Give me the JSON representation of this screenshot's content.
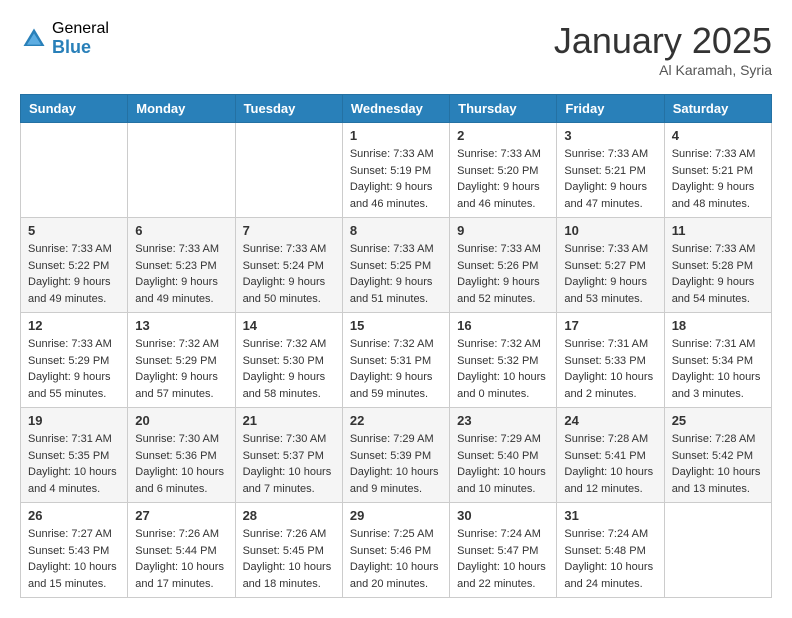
{
  "header": {
    "logo_general": "General",
    "logo_blue": "Blue",
    "month": "January 2025",
    "location": "Al Karamah, Syria"
  },
  "days_of_week": [
    "Sunday",
    "Monday",
    "Tuesday",
    "Wednesday",
    "Thursday",
    "Friday",
    "Saturday"
  ],
  "weeks": [
    [
      {
        "day": "",
        "info": ""
      },
      {
        "day": "",
        "info": ""
      },
      {
        "day": "",
        "info": ""
      },
      {
        "day": "1",
        "info": "Sunrise: 7:33 AM\nSunset: 5:19 PM\nDaylight: 9 hours and 46 minutes."
      },
      {
        "day": "2",
        "info": "Sunrise: 7:33 AM\nSunset: 5:20 PM\nDaylight: 9 hours and 46 minutes."
      },
      {
        "day": "3",
        "info": "Sunrise: 7:33 AM\nSunset: 5:21 PM\nDaylight: 9 hours and 47 minutes."
      },
      {
        "day": "4",
        "info": "Sunrise: 7:33 AM\nSunset: 5:21 PM\nDaylight: 9 hours and 48 minutes."
      }
    ],
    [
      {
        "day": "5",
        "info": "Sunrise: 7:33 AM\nSunset: 5:22 PM\nDaylight: 9 hours and 49 minutes."
      },
      {
        "day": "6",
        "info": "Sunrise: 7:33 AM\nSunset: 5:23 PM\nDaylight: 9 hours and 49 minutes."
      },
      {
        "day": "7",
        "info": "Sunrise: 7:33 AM\nSunset: 5:24 PM\nDaylight: 9 hours and 50 minutes."
      },
      {
        "day": "8",
        "info": "Sunrise: 7:33 AM\nSunset: 5:25 PM\nDaylight: 9 hours and 51 minutes."
      },
      {
        "day": "9",
        "info": "Sunrise: 7:33 AM\nSunset: 5:26 PM\nDaylight: 9 hours and 52 minutes."
      },
      {
        "day": "10",
        "info": "Sunrise: 7:33 AM\nSunset: 5:27 PM\nDaylight: 9 hours and 53 minutes."
      },
      {
        "day": "11",
        "info": "Sunrise: 7:33 AM\nSunset: 5:28 PM\nDaylight: 9 hours and 54 minutes."
      }
    ],
    [
      {
        "day": "12",
        "info": "Sunrise: 7:33 AM\nSunset: 5:29 PM\nDaylight: 9 hours and 55 minutes."
      },
      {
        "day": "13",
        "info": "Sunrise: 7:32 AM\nSunset: 5:29 PM\nDaylight: 9 hours and 57 minutes."
      },
      {
        "day": "14",
        "info": "Sunrise: 7:32 AM\nSunset: 5:30 PM\nDaylight: 9 hours and 58 minutes."
      },
      {
        "day": "15",
        "info": "Sunrise: 7:32 AM\nSunset: 5:31 PM\nDaylight: 9 hours and 59 minutes."
      },
      {
        "day": "16",
        "info": "Sunrise: 7:32 AM\nSunset: 5:32 PM\nDaylight: 10 hours and 0 minutes."
      },
      {
        "day": "17",
        "info": "Sunrise: 7:31 AM\nSunset: 5:33 PM\nDaylight: 10 hours and 2 minutes."
      },
      {
        "day": "18",
        "info": "Sunrise: 7:31 AM\nSunset: 5:34 PM\nDaylight: 10 hours and 3 minutes."
      }
    ],
    [
      {
        "day": "19",
        "info": "Sunrise: 7:31 AM\nSunset: 5:35 PM\nDaylight: 10 hours and 4 minutes."
      },
      {
        "day": "20",
        "info": "Sunrise: 7:30 AM\nSunset: 5:36 PM\nDaylight: 10 hours and 6 minutes."
      },
      {
        "day": "21",
        "info": "Sunrise: 7:30 AM\nSunset: 5:37 PM\nDaylight: 10 hours and 7 minutes."
      },
      {
        "day": "22",
        "info": "Sunrise: 7:29 AM\nSunset: 5:39 PM\nDaylight: 10 hours and 9 minutes."
      },
      {
        "day": "23",
        "info": "Sunrise: 7:29 AM\nSunset: 5:40 PM\nDaylight: 10 hours and 10 minutes."
      },
      {
        "day": "24",
        "info": "Sunrise: 7:28 AM\nSunset: 5:41 PM\nDaylight: 10 hours and 12 minutes."
      },
      {
        "day": "25",
        "info": "Sunrise: 7:28 AM\nSunset: 5:42 PM\nDaylight: 10 hours and 13 minutes."
      }
    ],
    [
      {
        "day": "26",
        "info": "Sunrise: 7:27 AM\nSunset: 5:43 PM\nDaylight: 10 hours and 15 minutes."
      },
      {
        "day": "27",
        "info": "Sunrise: 7:26 AM\nSunset: 5:44 PM\nDaylight: 10 hours and 17 minutes."
      },
      {
        "day": "28",
        "info": "Sunrise: 7:26 AM\nSunset: 5:45 PM\nDaylight: 10 hours and 18 minutes."
      },
      {
        "day": "29",
        "info": "Sunrise: 7:25 AM\nSunset: 5:46 PM\nDaylight: 10 hours and 20 minutes."
      },
      {
        "day": "30",
        "info": "Sunrise: 7:24 AM\nSunset: 5:47 PM\nDaylight: 10 hours and 22 minutes."
      },
      {
        "day": "31",
        "info": "Sunrise: 7:24 AM\nSunset: 5:48 PM\nDaylight: 10 hours and 24 minutes."
      },
      {
        "day": "",
        "info": ""
      }
    ]
  ]
}
